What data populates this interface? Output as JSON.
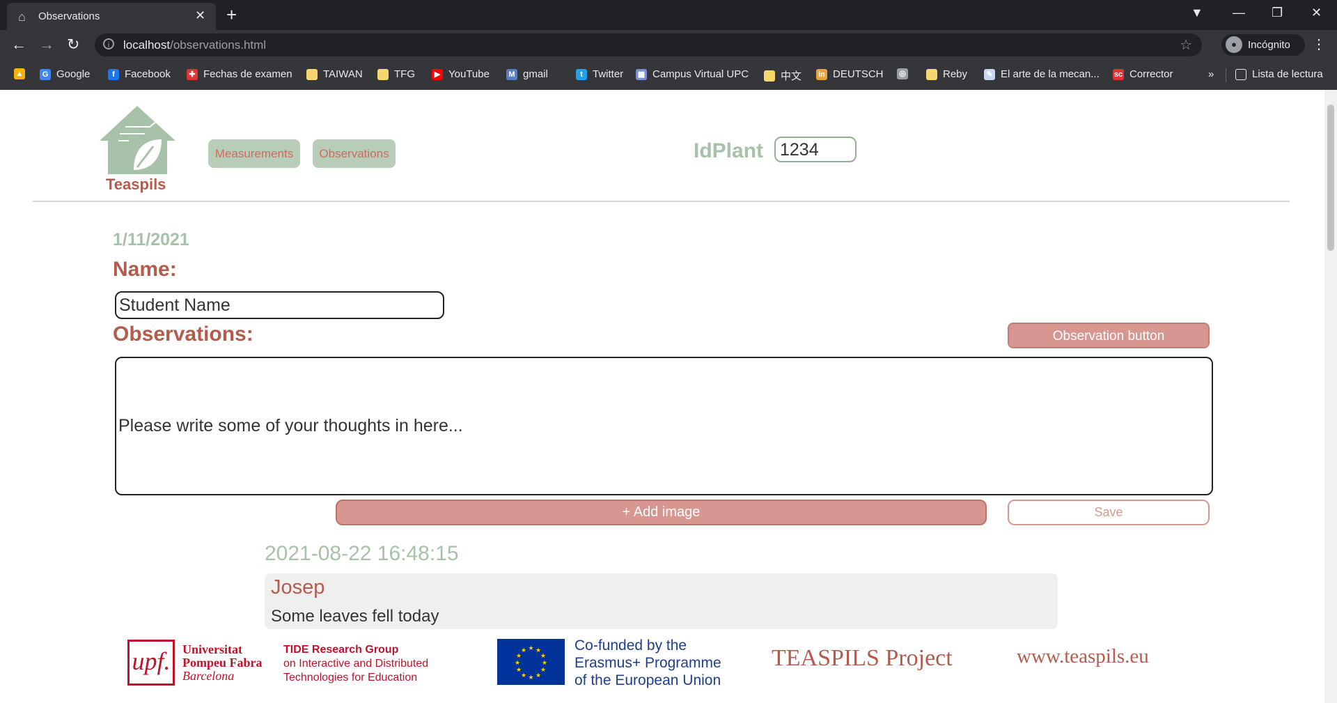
{
  "browser": {
    "tab_title": "Observations",
    "url_host": "localhost",
    "url_path": "/observations.html",
    "profile_label": "Incógnito",
    "bookmarks": [
      {
        "label": "",
        "icon": "google-drive-icon",
        "color": "#f4b400"
      },
      {
        "label": "Google",
        "icon": "google-icon",
        "color": "#4285f4"
      },
      {
        "label": "Facebook",
        "icon": "facebook-icon",
        "color": "#1877f2"
      },
      {
        "label": "Fechas de examen",
        "icon": "cross-icon",
        "color": "#d33"
      },
      {
        "label": "TAIWAN",
        "icon": "folder-icon",
        "color": "#f5d76e"
      },
      {
        "label": "TFG",
        "icon": "folder-icon",
        "color": "#f5d76e"
      },
      {
        "label": "YouTube",
        "icon": "youtube-icon",
        "color": "#ff0000"
      },
      {
        "label": "gmail",
        "icon": "gmail-icon",
        "color": "#5b7ec2"
      },
      {
        "label": "Twitter",
        "icon": "twitter-icon",
        "color": "#1da1f2"
      },
      {
        "label": "Campus Virtual UPC",
        "icon": "upc-icon",
        "color": "#7a8fd6"
      },
      {
        "label": "中文",
        "icon": "folder-icon",
        "color": "#f5d76e"
      },
      {
        "label": "DEUTSCH",
        "icon": "deutsch-icon",
        "color": "#e8a33c"
      },
      {
        "label": "",
        "icon": "globe-icon",
        "color": "#9aa0a6"
      },
      {
        "label": "Reby",
        "icon": "folder-icon",
        "color": "#f5d76e"
      },
      {
        "label": "El arte de la mecan...",
        "icon": "pen-icon",
        "color": "#c8d7f0"
      },
      {
        "label": "Corrector",
        "icon": "corrector-icon",
        "color": "#d33"
      }
    ],
    "overflow_label": "»",
    "reading_list_label": "Lista de lectura"
  },
  "header": {
    "logo_text": "Teaspils",
    "nav": [
      {
        "label": "Measurements"
      },
      {
        "label": "Observations"
      }
    ],
    "idplant_label": "IdPlant",
    "idplant_value": "1234"
  },
  "form": {
    "date": "1/11/2021",
    "name_label": "Name:",
    "name_value": "Student Name",
    "observations_label": "Observations:",
    "observation_button": "Observation button",
    "textarea_placeholder": "Please write some of your thoughts in here...",
    "add_image_label": "+ Add image",
    "save_label": "Save"
  },
  "entries": [
    {
      "timestamp": "2021-08-22 16:48:15",
      "author": "Josep",
      "text": "Some leaves fell today"
    }
  ],
  "footer": {
    "upf_logo": "upf.",
    "upf_lines": [
      "Universitat",
      "Pompeu Fabra",
      "Barcelona"
    ],
    "tide_lines": [
      "TIDE Research Group",
      "on Interactive and Distributed",
      "Technologies for Education"
    ],
    "eu_lines": [
      "Co-funded by the",
      "Erasmus+ Programme",
      "of the European Union"
    ],
    "project": "TEASPILS Project",
    "website": "www.teaspils.eu"
  },
  "colors": {
    "accent_green": "#a7c2a8",
    "accent_red": "#b55b4c",
    "button_pink": "#d79790"
  }
}
